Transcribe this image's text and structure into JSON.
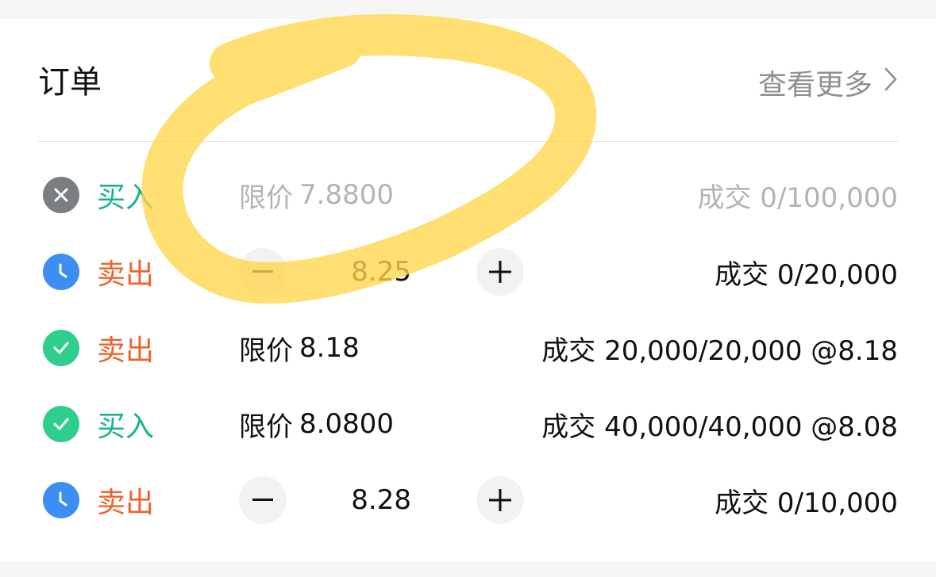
{
  "section": {
    "title": "订单",
    "more_label": "查看更多"
  },
  "orders": [
    {
      "status": "cancelled",
      "status_icon": "close-icon",
      "side": "买入",
      "side_type": "buy",
      "mode": "limit",
      "price_label": "限价",
      "price": "7.8800",
      "fill": "成交 0/100,000"
    },
    {
      "status": "pending",
      "status_icon": "clock-icon",
      "side": "卖出",
      "side_type": "sell",
      "mode": "stepper",
      "price": "8.25",
      "fill": "成交 0/20,000"
    },
    {
      "status": "filled",
      "status_icon": "check-icon",
      "side": "卖出",
      "side_type": "sell",
      "mode": "limit",
      "price_label": "限价",
      "price": "8.18",
      "fill": "成交 20,000/20,000 @8.18"
    },
    {
      "status": "filled",
      "status_icon": "check-icon",
      "side": "买入",
      "side_type": "buy",
      "mode": "limit",
      "price_label": "限价",
      "price": "8.0800",
      "fill": "成交 40,000/40,000 @8.08"
    },
    {
      "status": "pending",
      "status_icon": "clock-icon",
      "side": "卖出",
      "side_type": "sell",
      "mode": "stepper",
      "price": "8.28",
      "fill": "成交 0/10,000"
    }
  ],
  "colors": {
    "buy": "#19b394",
    "sell": "#f0622a",
    "cancelled_icon": "#7a7d82",
    "pending_icon": "#3d8ef2",
    "filled_icon": "#2ecf8c",
    "highlight": "#ffd54a"
  }
}
